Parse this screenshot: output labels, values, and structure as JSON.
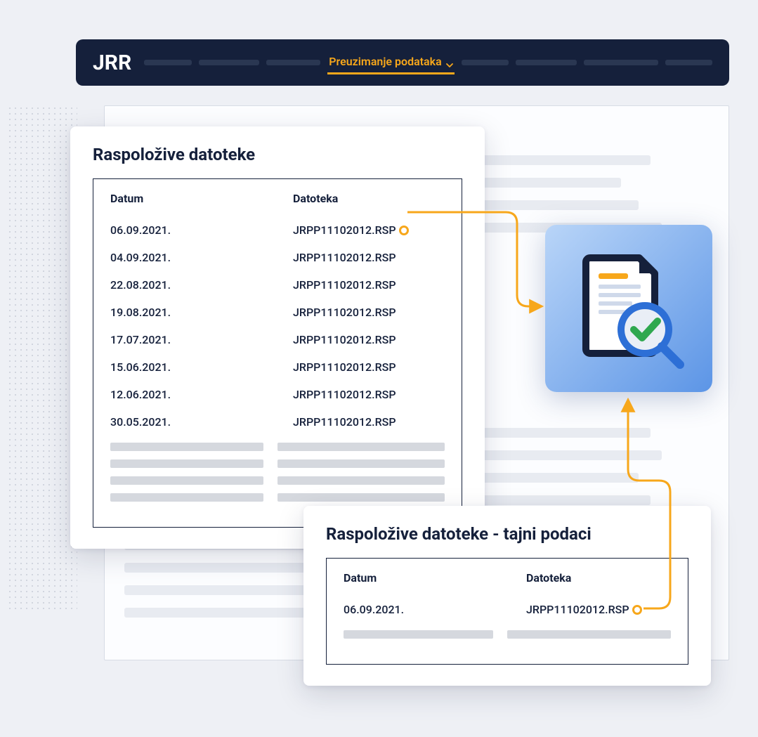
{
  "navbar": {
    "brand": "JRR",
    "active_menu_label": "Preuzimanje podataka"
  },
  "main_card": {
    "title": "Raspoložive datoteke",
    "columns": {
      "date": "Datum",
      "file": "Datoteka"
    },
    "rows": [
      {
        "date": "06.09.2021.",
        "file": "JRPP11102012.RSP"
      },
      {
        "date": "04.09.2021.",
        "file": "JRPP11102012.RSP"
      },
      {
        "date": "22.08.2021.",
        "file": "JRPP11102012.RSP"
      },
      {
        "date": "19.08.2021.",
        "file": "JRPP11102012.RSP"
      },
      {
        "date": "17.07.2021.",
        "file": "JRPP11102012.RSP"
      },
      {
        "date": "15.06.2021.",
        "file": "JRPP11102012.RSP"
      },
      {
        "date": "12.06.2021.",
        "file": "JRPP11102012.RSP"
      },
      {
        "date": "30.05.2021.",
        "file": "JRPP11102012.RSP"
      }
    ]
  },
  "secret_card": {
    "title": "Raspoložive datoteke - tajni podaci",
    "columns": {
      "date": "Datum",
      "file": "Datoteka"
    },
    "rows": [
      {
        "date": "06.09.2021.",
        "file": "JRPP11102012.RSP"
      }
    ]
  },
  "colors": {
    "navy": "#15203b",
    "accent": "#f7a71b",
    "blue_tile_start": "#b9d5f8",
    "blue_tile_end": "#5c95e6"
  },
  "icons": {
    "illustration": "document-verified-search-icon"
  }
}
